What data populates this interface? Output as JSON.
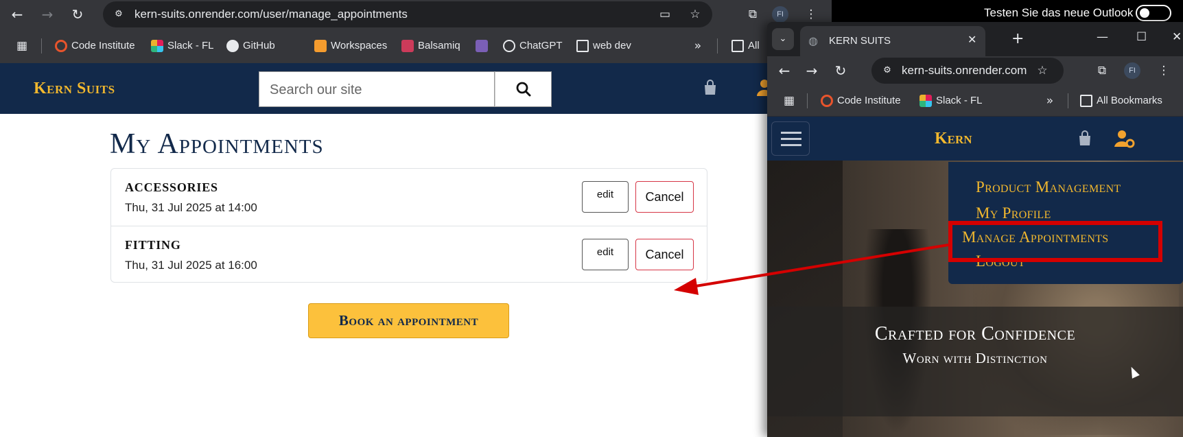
{
  "left_browser": {
    "url": "kern-suits.onrender.com/user/manage_appointments",
    "avatar": "FI",
    "bookmarks": [
      {
        "label": "Code Institute",
        "icon": "code-institute-icon"
      },
      {
        "label": "Slack - FL",
        "icon": "slack-icon"
      },
      {
        "label": "GitHub",
        "icon": "github-icon"
      },
      {
        "label": "Workspaces",
        "icon": "workspaces-icon"
      },
      {
        "label": "Balsamiq",
        "icon": "balsamiq-icon"
      },
      {
        "label": "",
        "icon": "heroku-icon"
      },
      {
        "label": "ChatGPT",
        "icon": "chatgpt-icon"
      },
      {
        "label": "web dev",
        "icon": "folder-icon"
      },
      {
        "label": "All",
        "icon": "folder-icon"
      }
    ]
  },
  "site": {
    "brand": "Kern Suits",
    "search_placeholder": "Search our site",
    "page_title": "My Appointments",
    "appointments": [
      {
        "title": "ACCESSORIES",
        "datetime": "Thu, 31 Jul 2025 at 14:00",
        "edit_label": "edit",
        "cancel_label": "Cancel"
      },
      {
        "title": "FITTING",
        "datetime": "Thu, 31 Jul 2025 at 16:00",
        "edit_label": "edit",
        "cancel_label": "Cancel"
      }
    ],
    "book_label": "Book an appointment"
  },
  "system_bar": {
    "outlook_text": "Testen Sie das neue Outlook"
  },
  "right_browser": {
    "tab_title": "KERN SUITS",
    "url": "kern-suits.onrender.com",
    "avatar": "FI",
    "bookmarks": [
      {
        "label": "Code Institute",
        "icon": "code-institute-icon"
      },
      {
        "label": "Slack - FL",
        "icon": "slack-icon"
      },
      {
        "label": "All Bookmarks",
        "icon": "folder-icon"
      }
    ],
    "brand": "Kern",
    "dropdown": [
      "Product Management",
      "My Profile",
      "Manage Appointments",
      "Logout"
    ],
    "hero_title": "Crafted for Confidence",
    "hero_subtitle": "Worn with Distinction"
  },
  "colors": {
    "navy": "#12294a",
    "gold": "#f2b82e",
    "book_button": "#fcc13c",
    "cancel_border": "#d63545",
    "annotation_red": "#d40000"
  }
}
